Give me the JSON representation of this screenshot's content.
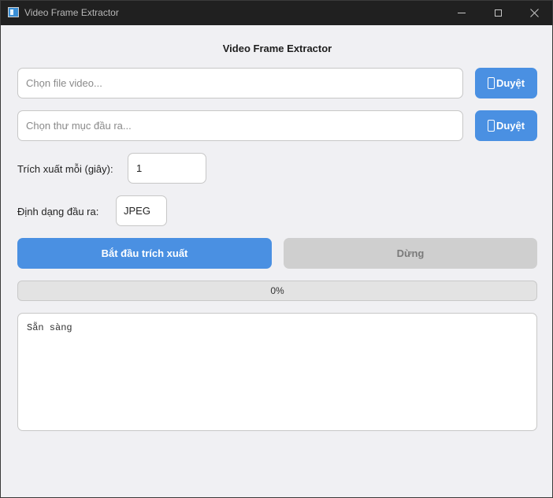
{
  "window": {
    "title": "Video Frame Extractor"
  },
  "main": {
    "heading": "Video Frame Extractor",
    "video_input": {
      "value": "",
      "placeholder": "Chọn file video..."
    },
    "output_input": {
      "value": "",
      "placeholder": "Chọn thư mục đầu ra..."
    },
    "browse_label": "Duyệt",
    "interval_label": "Trích xuất mỗi (giây):",
    "interval_value": "1",
    "format_label": "Định dạng đầu ra:",
    "format_value": "JPEG",
    "start_label": "Bắt đầu trích xuất",
    "stop_label": "Dừng",
    "progress": {
      "percent": 0,
      "text": "0%"
    },
    "log_text": "Sẵn sàng"
  },
  "colors": {
    "accent": "#4a90e2",
    "disabled": "#cfcfcf",
    "background": "#f0f0f3",
    "titlebar": "#202020"
  },
  "icons": {
    "app": "app-icon",
    "browse": "phone-icon"
  }
}
